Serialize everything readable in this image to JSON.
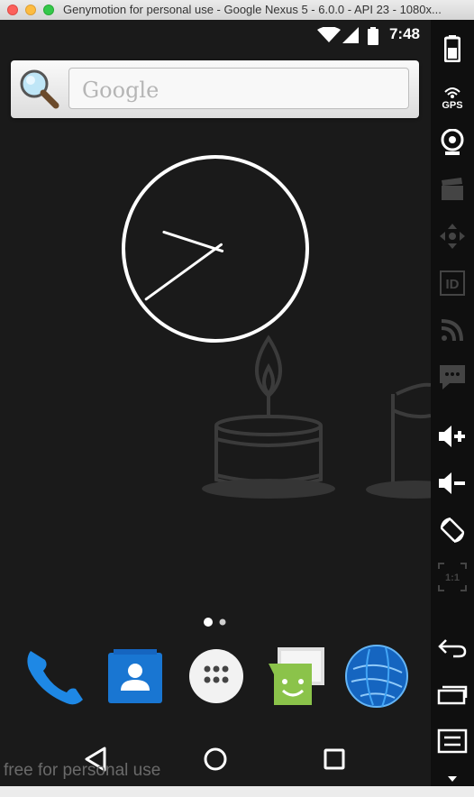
{
  "window": {
    "title": "Genymotion for personal use - Google Nexus 5 - 6.0.0 - API 23 - 1080x..."
  },
  "status_bar": {
    "time": "7:48"
  },
  "search": {
    "placeholder": "Google"
  },
  "clock": {
    "hours": 7,
    "minutes": 48
  },
  "home": {
    "page_count": 2,
    "current_page": 0
  },
  "dock": {
    "apps": [
      "Phone",
      "Contacts",
      "Apps",
      "Messenger",
      "Browser"
    ]
  },
  "watermark": "free for personal use",
  "side_panel": {
    "tools": [
      "battery",
      "gps",
      "webcam",
      "capture",
      "dpad",
      "id",
      "network",
      "sms",
      "volume-up",
      "volume-down",
      "rotate",
      "pixel-perfect",
      "back",
      "recent-apps",
      "menu",
      "more"
    ],
    "gps_label": "GPS",
    "id_label": "ID",
    "pixel_label": "1:1"
  },
  "colors": {
    "screen_bg": "#1a1a1a",
    "panel_bg": "#0f0f0f",
    "clock": "#ffffff",
    "wallpaper": "#3a3a3a"
  }
}
